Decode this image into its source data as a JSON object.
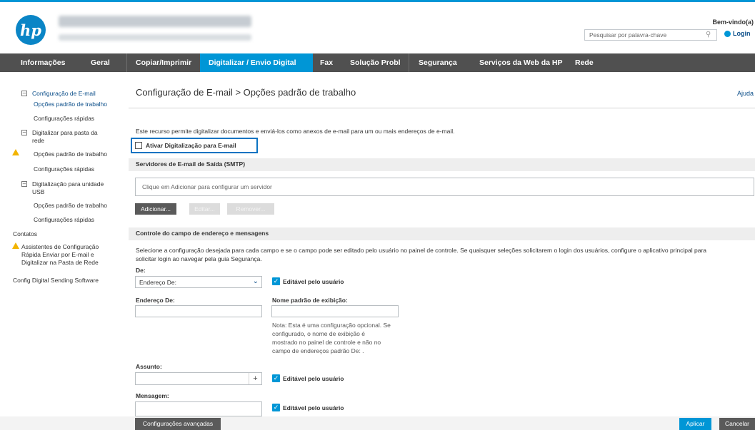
{
  "header": {
    "logo_text": "hp",
    "welcome": "Bem-vindo(a)",
    "search_placeholder": "Pesquisar por palavra-chave",
    "login": "Login"
  },
  "nav": {
    "items": [
      "Informações",
      "Geral",
      "Copiar/Imprimir",
      "Digitalizar / Envio Digital",
      "Fax",
      "Solução Probl",
      "Segurança",
      "Serviços da Web da HP",
      "Rede"
    ],
    "active_index": 3
  },
  "sidebar": {
    "email_config": "Configuração de E-mail",
    "email_default_opts": "Opções padrão de trabalho",
    "email_quick": "Configurações rápidas",
    "folder_line1": "Digitalizar para pasta da",
    "folder_line2": "rede",
    "folder_default_opts": "Opções padrão de trabalho",
    "folder_quick": "Configurações rápidas",
    "usb_line1": "Digitalização para unidade",
    "usb_line2": "USB",
    "usb_default_opts": "Opções padrão de trabalho",
    "usb_quick": "Configurações rápidas",
    "contacts": "Contatos",
    "wizard_line1": "Assistentes de Configuração",
    "wizard_line2": "Rápida Enviar por E-mail e",
    "wizard_line3": "Digitalizar na Pasta de Rede",
    "digital_sending": "Config Digital Sending Software"
  },
  "main": {
    "title": "Configuração de E-mail > Opções padrão de trabalho",
    "help": "Ajuda",
    "intro": "Este recurso permite digitalizar documentos e enviá-los como anexos de e-mail para um ou mais endereços de e-mail.",
    "enable_label": "Ativar Digitalização para E-mail",
    "smtp_section": "Servidores de E-mail de Saída (SMTP)",
    "smtp_placeholder": "Clique em Adicionar para configurar um servidor",
    "add_button": "Adicionar...",
    "edit_button": "Editar...",
    "remove_button": "Remover...",
    "address_section": "Controle do campo de endereço e mensagens",
    "address_para_1": "Selecione a configuração desejada para cada campo e se o campo pode ser editado pelo usuário no painel de controle. Se quaisquer seleções solicitarem o login dos usuários, configure o aplicativo principal para",
    "address_para_2": "solicitar login ao navegar pela guia Segurança.",
    "from_label": "De:",
    "from_select_value": "Endereço De:",
    "editable_label": "Editável pelo usuário",
    "from_address_label": "Endereço De:",
    "display_name_label": "Nome padrão de exibição:",
    "note": [
      "Nota: Esta é uma configuração opcional. Se",
      "configurado, o nome de exibição é",
      "mostrado no painel de controle e não no",
      "campo de endereços padrão De: ."
    ],
    "subject_label": "Assunto:",
    "message_label": "Mensagem:",
    "advanced_button": "Configurações avançadas",
    "apply_button": "Aplicar",
    "cancel_button": "Cancelar"
  },
  "colors": {
    "accent": "#0096d6",
    "nav_bg": "#505050",
    "link": "#0b4e89",
    "warning": "#f2b400"
  }
}
